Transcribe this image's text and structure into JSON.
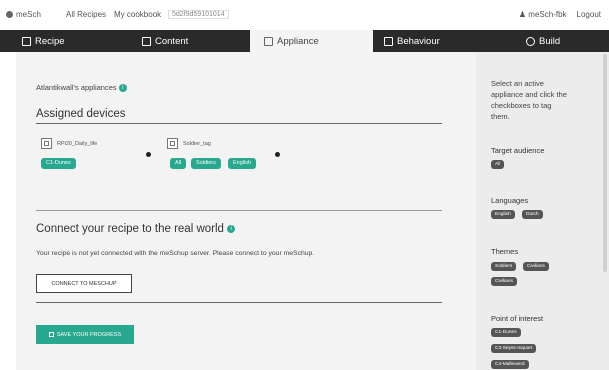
{
  "topbar": {
    "brand": "meSch",
    "nav": [
      "All Recipes",
      "My cookbook"
    ],
    "recipe_id": "5d2f9d59101014",
    "user": "meSch-fbk",
    "logout": "Logout"
  },
  "tabs": [
    {
      "label": "Recipe",
      "icon": "recipe-icon"
    },
    {
      "label": "Content",
      "icon": "monitor-icon"
    },
    {
      "label": "Appliance",
      "icon": "device-icon",
      "active": true
    },
    {
      "label": "Behaviour",
      "icon": "list-icon"
    },
    {
      "label": "Build",
      "icon": "gear-icon"
    }
  ],
  "main": {
    "appliances_label": "Atlantikwall's appliances",
    "assigned_title": "Assigned devices",
    "devices": [
      {
        "name": "RPi20_Daily_life",
        "tags": [
          "C1-Dunes"
        ]
      },
      {
        "name": "Soldier_tag",
        "tags": [
          "All",
          "Soldiers",
          "English"
        ]
      }
    ],
    "connect_title": "Connect your recipe to the real world",
    "connect_text": "Your recipe is not yet connected with the meSchup server. Please connect to your meSchup.",
    "connect_button": "CONNECT TO MESCHUP",
    "save_button": "SAVE YOUR PROGRESS"
  },
  "sidebar": {
    "intro": [
      "Select an active",
      "appliance and click the",
      "checkboxes to tag",
      "them."
    ],
    "target_audience": {
      "title": "Target audience",
      "tags": [
        "All"
      ]
    },
    "languages": {
      "title": "Languages",
      "tags": [
        "English",
        "Dutch"
      ]
    },
    "themes": {
      "title": "Themes",
      "tags": [
        "Soldiers",
        "Civilians",
        "Civilians"
      ]
    },
    "poi": {
      "title": "Point of interest",
      "tags": [
        "C1-Dunes",
        "C3-Seyss-Inquart",
        "C4-Mallewerd"
      ]
    }
  },
  "colors": {
    "accent": "#27a88f",
    "tab_bar": "#2a2a2a",
    "panel": "#f3f3f3"
  }
}
